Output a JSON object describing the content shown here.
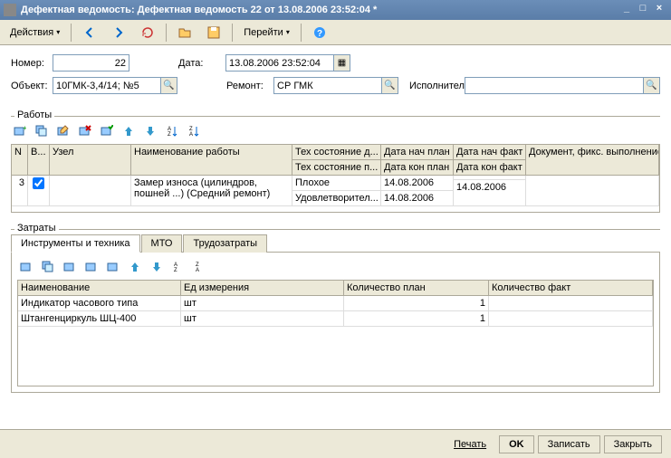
{
  "window": {
    "title": "Дефектная ведомость:  Дефектная ведомость 22 от 13.08.2006 23:52:04 *"
  },
  "toolbar": {
    "actions": "Действия",
    "go": "Перейти"
  },
  "form": {
    "number_label": "Номер:",
    "number": "22",
    "date_label": "Дата:",
    "date": "13.08.2006 23:52:04",
    "object_label": "Объект:",
    "object": "10ГМК-3,4/14; №5",
    "repair_label": "Ремонт:",
    "repair": "СР ГМК",
    "executor_label": "Исполнитель:",
    "executor": ""
  },
  "works": {
    "title": "Работы",
    "columns": {
      "n": "N",
      "b": "В...",
      "node": "Узел",
      "name": "Наименование работы",
      "tech1": "Тех состояние д...",
      "tech2": "Тех состояние п...",
      "date_start_plan": "Дата нач план",
      "date_end_plan": "Дата кон план",
      "date_start_fact": "Дата нач факт",
      "date_end_fact": "Дата кон факт",
      "doc": "Документ, фикс. выполнение"
    },
    "rows": [
      {
        "n": "3",
        "b": true,
        "node": "",
        "name": "Замер износа (цилиндров, пошней ...) (Средний ремонт)",
        "tech1": "Плохое",
        "tech2": "Удовлетворител...",
        "date1a": "14.08.2006",
        "date1b": "14.08.2006",
        "date2a": "",
        "date2b": "14.08.2006",
        "doc": ""
      }
    ]
  },
  "costs": {
    "title": "Затраты",
    "tabs": [
      "Инструменты и техника",
      "МТО",
      "Трудозатраты"
    ],
    "tools": {
      "columns": {
        "name": "Наименование",
        "unit": "Ед измерения",
        "qty_plan": "Количество план",
        "qty_fact": "Количество факт"
      },
      "rows": [
        {
          "name": "Индикатор часового типа",
          "unit": "шт",
          "qty_plan": "1",
          "qty_fact": ""
        },
        {
          "name": "Штангенциркуль ШЦ-400",
          "unit": "шт",
          "qty_plan": "1",
          "qty_fact": ""
        }
      ]
    }
  },
  "footer": {
    "print": "Печать",
    "ok": "OK",
    "save": "Записать",
    "close": "Закрыть"
  }
}
